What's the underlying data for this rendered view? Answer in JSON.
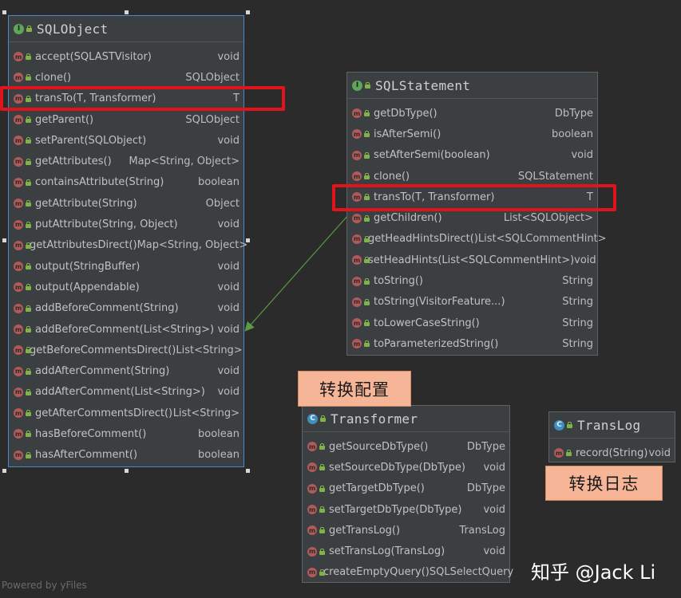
{
  "classes": {
    "sqlobject": {
      "kind_letter": "I",
      "title": "SQLObject",
      "methods": [
        {
          "name": "accept(SQLASTVisitor)",
          "ret": "void"
        },
        {
          "name": "clone()",
          "ret": "SQLObject"
        },
        {
          "name": "transTo(T, Transformer)",
          "ret": "T"
        },
        {
          "name": "getParent()",
          "ret": "SQLObject"
        },
        {
          "name": "setParent(SQLObject)",
          "ret": "void"
        },
        {
          "name": "getAttributes()",
          "ret": "Map<String, Object>"
        },
        {
          "name": "containsAttribute(String)",
          "ret": "boolean"
        },
        {
          "name": "getAttribute(String)",
          "ret": "Object"
        },
        {
          "name": "putAttribute(String, Object)",
          "ret": "void"
        },
        {
          "name": "getAttributesDirect()",
          "ret": "Map<String, Object>"
        },
        {
          "name": "output(StringBuffer)",
          "ret": "void"
        },
        {
          "name": "output(Appendable)",
          "ret": "void"
        },
        {
          "name": "addBeforeComment(String)",
          "ret": "void"
        },
        {
          "name": "addBeforeComment(List<String>)",
          "ret": "void"
        },
        {
          "name": "getBeforeCommentsDirect()",
          "ret": "List<String>"
        },
        {
          "name": "addAfterComment(String)",
          "ret": "void"
        },
        {
          "name": "addAfterComment(List<String>)",
          "ret": "void"
        },
        {
          "name": "getAfterCommentsDirect()",
          "ret": "List<String>"
        },
        {
          "name": "hasBeforeComment()",
          "ret": "boolean"
        },
        {
          "name": "hasAfterComment()",
          "ret": "boolean"
        }
      ]
    },
    "sqlstatement": {
      "kind_letter": "I",
      "title": "SQLStatement",
      "methods": [
        {
          "name": "getDbType()",
          "ret": "DbType"
        },
        {
          "name": "isAfterSemi()",
          "ret": "boolean"
        },
        {
          "name": "setAfterSemi(boolean)",
          "ret": "void"
        },
        {
          "name": "clone()",
          "ret": "SQLStatement"
        },
        {
          "name": "transTo(T, Transformer)",
          "ret": "T"
        },
        {
          "name": "getChildren()",
          "ret": "List<SQLObject>"
        },
        {
          "name": "getHeadHintsDirect()",
          "ret": "List<SQLCommentHint>"
        },
        {
          "name": "setHeadHints(List<SQLCommentHint>)",
          "ret": "void"
        },
        {
          "name": "toString()",
          "ret": "String"
        },
        {
          "name": "toString(VisitorFeature...)",
          "ret": "String"
        },
        {
          "name": "toLowerCaseString()",
          "ret": "String"
        },
        {
          "name": "toParameterizedString()",
          "ret": "String"
        }
      ]
    },
    "transformer": {
      "kind_letter": "C",
      "title": "Transformer",
      "methods": [
        {
          "name": "getSourceDbType()",
          "ret": "DbType"
        },
        {
          "name": "setSourceDbType(DbType)",
          "ret": "void"
        },
        {
          "name": "getTargetDbType()",
          "ret": "DbType"
        },
        {
          "name": "setTargetDbType(DbType)",
          "ret": "void"
        },
        {
          "name": "getTransLog()",
          "ret": "TransLog"
        },
        {
          "name": "setTransLog(TransLog)",
          "ret": "void"
        },
        {
          "name": "createEmptyQuery()",
          "ret": "SQLSelectQuery"
        }
      ]
    },
    "translog": {
      "kind_letter": "C",
      "title": "TransLog",
      "methods": [
        {
          "name": "record(String)",
          "ret": "void"
        }
      ]
    }
  },
  "method_icon_letter": "m",
  "tags": {
    "transform_config": "转换配置",
    "transform_log": "转换日志"
  },
  "footer": "Powered by yFiles",
  "watermark": "知乎 @Jack Li",
  "colors": {
    "highlight": "#e2141b",
    "tag_bg": "#f6b597",
    "edge": "#5c9a43",
    "selection": "#4a88c7"
  }
}
